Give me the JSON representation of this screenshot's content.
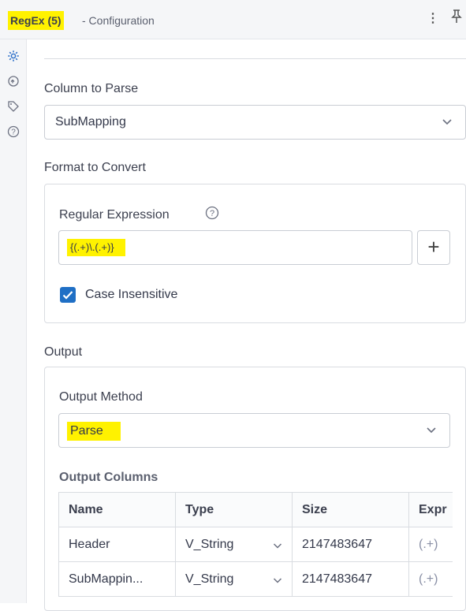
{
  "header": {
    "tool_name": "RegEx (5)",
    "title_suffix": "- Configuration",
    "menu_icon": "kebab-menu-icon",
    "pin_icon": "pin-icon",
    "highlight_color": "#fff200"
  },
  "sidebar": {
    "items": [
      {
        "icon": "gear-icon",
        "active": true
      },
      {
        "icon": "cycle-icon",
        "active": false
      },
      {
        "icon": "tag-icon",
        "active": false
      },
      {
        "icon": "help-icon",
        "active": false
      }
    ],
    "accent_color": "#2c6fc9"
  },
  "column_to_parse": {
    "label": "Column to Parse",
    "value": "SubMapping"
  },
  "format_to_convert": {
    "label": "Format to Convert",
    "regex_label": "Regular Expression",
    "regex_value": "{(.+)\\.(.+)}",
    "add_button": "+",
    "case_insensitive_label": "Case Insensitive",
    "case_insensitive_checked": true
  },
  "output": {
    "label": "Output",
    "method_label": "Output Method",
    "method_value": "Parse",
    "columns_label": "Output Columns",
    "table": {
      "headers": [
        "Name",
        "Type",
        "Size",
        "Expr"
      ],
      "rows": [
        [
          "Header",
          "V_String",
          "2147483647",
          "(.+)"
        ],
        [
          "SubMappin...",
          "V_String",
          "2147483647",
          "(.+)"
        ]
      ]
    }
  }
}
